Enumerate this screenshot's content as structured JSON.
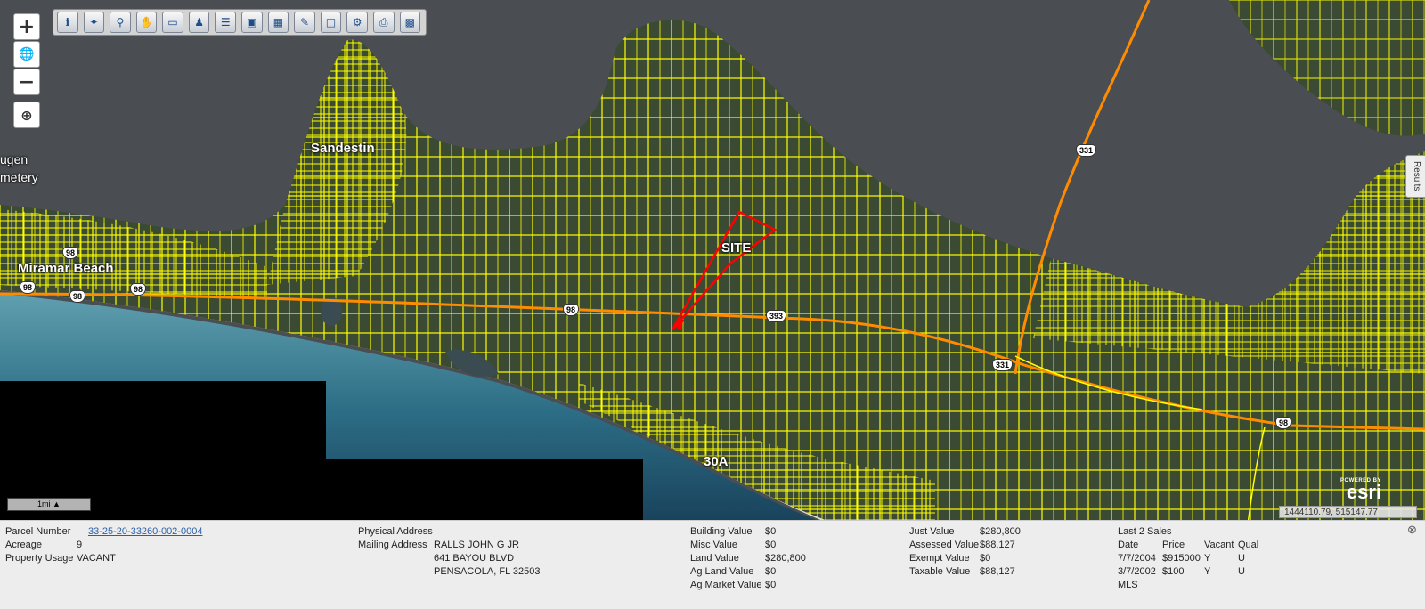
{
  "map": {
    "zoom_in_label": "+",
    "zoom_out_label": "−",
    "globe_icon": "globe-icon",
    "locate_icon": "crosshair-icon",
    "labels": [
      {
        "id": "sandestin",
        "text": "Sandestin"
      },
      {
        "id": "miramar",
        "text": "Miramar Beach"
      },
      {
        "id": "site",
        "text": "SITE"
      },
      {
        "id": "30a",
        "text": "30A"
      },
      {
        "id": "ugen",
        "text": "ugen"
      },
      {
        "id": "metery",
        "text": "metery"
      }
    ],
    "shields": [
      "98",
      "98",
      "98",
      "98",
      "98",
      "393",
      "331",
      "331",
      "98"
    ],
    "results_tab": "Results",
    "scale_label": "1mi ▲",
    "esri_powered": "POWERED BY",
    "esri_brand": "esri",
    "coordinates": "1444110.79, 515147.77",
    "colors": {
      "parcel": "#ffff00",
      "site": "#ff0000",
      "road": "#ff8c00",
      "water": "#4a4d52"
    }
  },
  "toolbar": {
    "tools": [
      "info-icon",
      "identify-icon",
      "zoom-to-icon",
      "pan-icon",
      "eraser-icon",
      "person-icon",
      "layers-icon",
      "photo-icon",
      "buffer-icon",
      "draw-icon",
      "select-icon",
      "measure-icon",
      "print-icon",
      "save-icon"
    ]
  },
  "parcel": {
    "parcel_number_label": "Parcel Number",
    "parcel_number": "33-25-20-33260-002-0004",
    "acreage_label": "Acreage",
    "acreage": "9",
    "usage_label": "Property Usage",
    "usage": "VACANT",
    "physical_address_label": "Physical Address",
    "mailing_address_label": "Mailing Address",
    "mailing_line1": "RALLS JOHN G JR",
    "mailing_line2": "641 BAYOU BLVD",
    "mailing_line3": "PENSACOLA, FL 32503"
  },
  "values": {
    "building_label": "Building Value",
    "building": "$0",
    "misc_label": "Misc Value",
    "misc": "$0",
    "land_label": "Land Value",
    "land": "$280,800",
    "ag_land_label": "Ag Land Value",
    "ag_land": "$0",
    "ag_market_label": "Ag Market Value",
    "ag_market": "$0"
  },
  "assessment": {
    "just_label": "Just Value",
    "just": "$280,800",
    "assessed_label": "Assessed Value",
    "assessed": "$88,127",
    "exempt_label": "Exempt Value",
    "exempt": "$0",
    "taxable_label": "Taxable Value",
    "taxable": "$88,127"
  },
  "sales": {
    "title": "Last 2 Sales",
    "headers": [
      "Date",
      "Price",
      "Vacant",
      "Qual"
    ],
    "rows": [
      [
        "7/7/2004",
        "$915000",
        "Y",
        "U"
      ],
      [
        "3/7/2002",
        "$100",
        "Y",
        "U"
      ]
    ],
    "mls_label": "MLS"
  }
}
